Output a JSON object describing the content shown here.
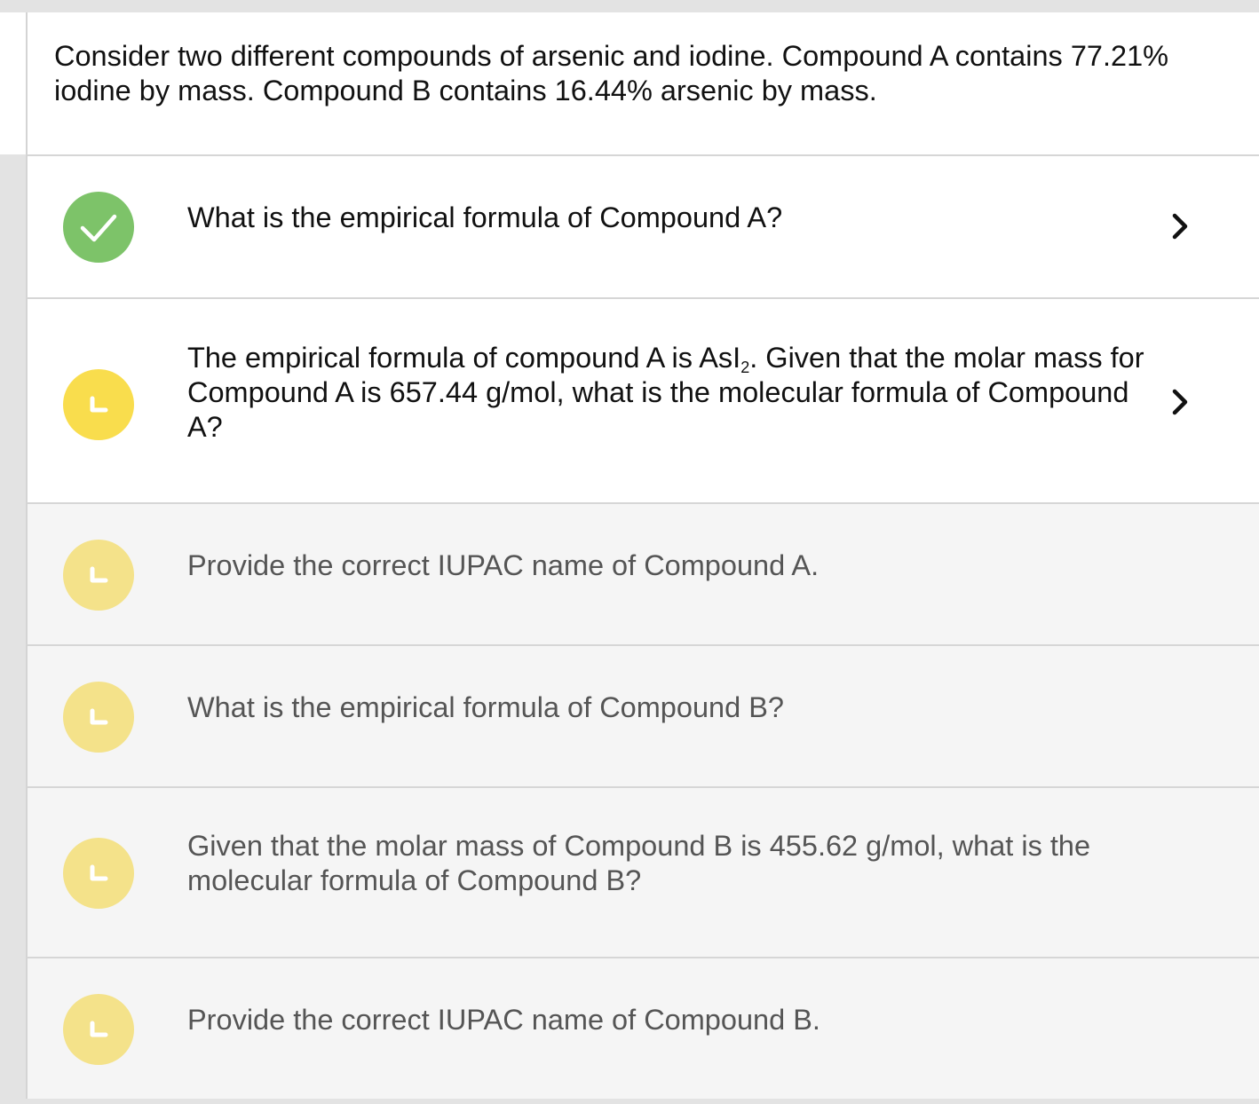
{
  "problem": {
    "statement": "Consider two different compounds of arsenic and iodine. Compound A contains 77.21% iodine by mass. Compound B contains 16.44% arsenic by mass."
  },
  "steps": [
    {
      "status": "complete",
      "status_icon": "check-icon",
      "text": "What is the empirical formula of Compound A?",
      "expand_icon": "chevron-right-icon"
    },
    {
      "status": "in-progress",
      "status_icon": "corner-icon",
      "text_parts": {
        "before": "The empirical formula of compound A is AsI",
        "subscript": "2",
        "after": ". Given that the molar mass for Compound A is 657.44 g/mol, what is the molecular formula of Compound A?"
      },
      "expand_icon": "chevron-right-icon"
    },
    {
      "status": "locked",
      "status_icon": "corner-icon",
      "text": "Provide the correct IUPAC name of Compound A."
    },
    {
      "status": "locked",
      "status_icon": "corner-icon",
      "text": "What is the empirical formula of Compound B?"
    },
    {
      "status": "locked",
      "status_icon": "corner-icon",
      "text": "Given that the molar mass of Compound B is 455.62 g/mol, what is the molecular formula of Compound B?"
    },
    {
      "status": "locked",
      "status_icon": "corner-icon",
      "text": "Provide the correct IUPAC name of Compound B."
    }
  ],
  "colors": {
    "complete": "#7dc369",
    "in_progress": "#f9dd4d",
    "locked": "#f4e28a",
    "active_background": "#ffffff",
    "locked_background": "#f5f5f5",
    "page_background": "#e3e3e3"
  }
}
